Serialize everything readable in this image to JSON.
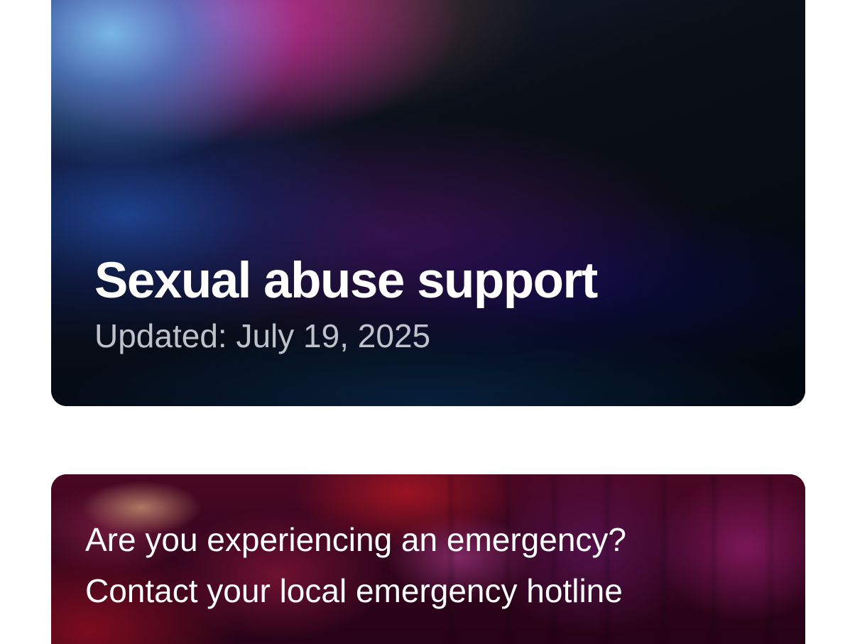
{
  "hero": {
    "title": "Sexual abuse support",
    "updated": "Updated: July 19, 2025"
  },
  "emergency": {
    "line1": "Are you experiencing an emergency?",
    "line2": "Contact your local emergency hotline"
  },
  "colors": {
    "page_background": "#ffffff",
    "hero_dark": "#05080f",
    "emergency_base": "#3a0620",
    "title_text": "#ffffff",
    "subtitle_text": "#d7dce4"
  }
}
